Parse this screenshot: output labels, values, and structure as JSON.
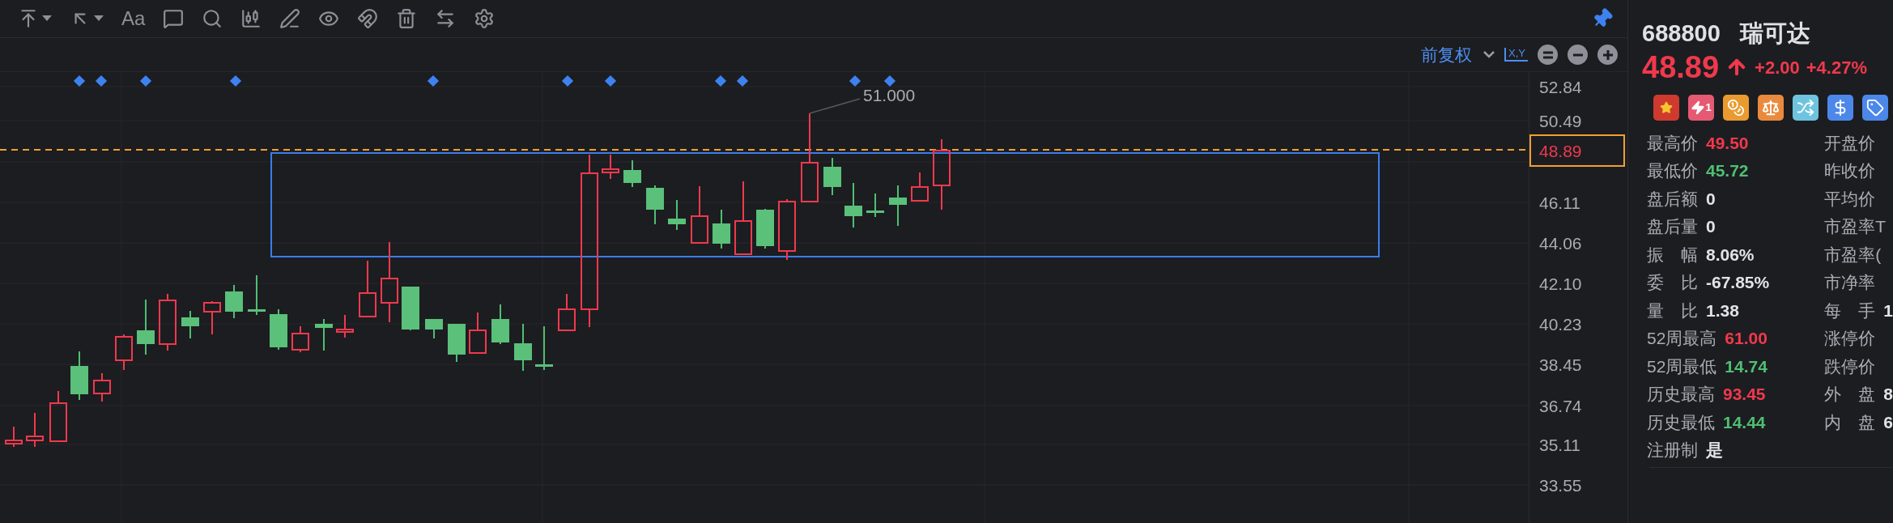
{
  "toolbar": {
    "text_tool": "Aa"
  },
  "chart_controls": {
    "adjust_mode": "前复权",
    "axis_toggle": "X,Y"
  },
  "chart": {
    "high_annotation": "51.000",
    "price_axis": [
      "52.84",
      "50.49",
      "46.11",
      "44.06",
      "42.10",
      "40.23",
      "38.45",
      "36.74",
      "35.11",
      "33.55"
    ],
    "current_price": "48.89"
  },
  "quote": {
    "code": "688800",
    "name": "瑞可达",
    "price": "48.89",
    "change": "+2.00",
    "change_pct": "+4.27%",
    "rising": true
  },
  "badges": [
    {
      "kind": "flag"
    },
    {
      "kind": "flash",
      "label": "1"
    },
    {
      "kind": "coins"
    },
    {
      "kind": "scale"
    },
    {
      "kind": "shuffle"
    },
    {
      "kind": "dollar"
    },
    {
      "kind": "tag"
    }
  ],
  "stats_left": [
    {
      "label": "最高价",
      "value": "49.50",
      "color": "#f0394c"
    },
    {
      "label": "最低价",
      "value": "45.72",
      "color": "#4fbf72"
    },
    {
      "label": "盘后额",
      "value": "0",
      "color": "#e1e3e8"
    },
    {
      "label": "盘后量",
      "value": "0",
      "color": "#e1e3e8"
    },
    {
      "label": "振　幅",
      "value": "8.06%",
      "color": "#e1e3e8"
    },
    {
      "label": "委　比",
      "value": "-67.85%",
      "color": "#e1e3e8"
    },
    {
      "label": "量　比",
      "value": "1.38",
      "color": "#e1e3e8"
    },
    {
      "label": "52周最高",
      "value": "61.00",
      "color": "#f0394c"
    },
    {
      "label": "52周最低",
      "value": "14.74",
      "color": "#4fbf72"
    },
    {
      "label": "历史最高",
      "value": "93.45",
      "color": "#f0394c"
    },
    {
      "label": "历史最低",
      "value": "14.44",
      "color": "#4fbf72"
    },
    {
      "label": "注册制",
      "value": "是",
      "color": "#e1e3e8"
    }
  ],
  "stats_right": [
    {
      "label": "开盘价"
    },
    {
      "label": "昨收价"
    },
    {
      "label": "平均价"
    },
    {
      "label": "市盈率T"
    },
    {
      "label": "市盈率("
    },
    {
      "label": "市净率"
    },
    {
      "label": "每　手",
      "value": "1",
      "color": "#e1e3e8"
    },
    {
      "label": "涨停价"
    },
    {
      "label": "跌停价"
    },
    {
      "label": "外　盘",
      "value": "8",
      "color": "#e1e3e8"
    },
    {
      "label": "内　盘",
      "value": "6",
      "color": "#e1e3e8"
    }
  ]
}
